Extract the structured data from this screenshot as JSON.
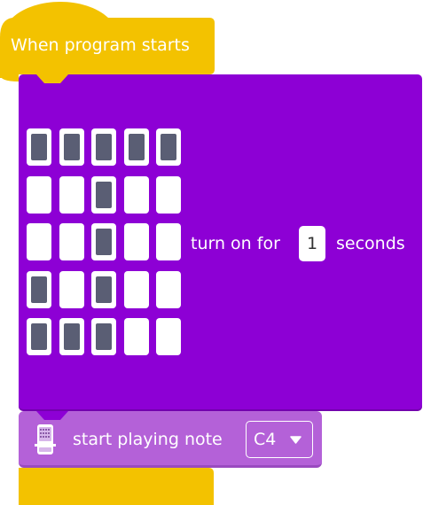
{
  "hat_block": {
    "label": "When program starts",
    "color": "#f3c200"
  },
  "led_block": {
    "color": "#8d00d5",
    "matrix": [
      [
        1,
        1,
        1,
        1,
        1
      ],
      [
        0,
        0,
        1,
        0,
        0
      ],
      [
        0,
        0,
        1,
        0,
        0
      ],
      [
        1,
        0,
        1,
        0,
        0
      ],
      [
        1,
        1,
        1,
        0,
        0
      ]
    ],
    "text_before": "turn on for",
    "seconds_value": "1",
    "text_after": "seconds"
  },
  "note_block": {
    "icon": "microbit-icon",
    "label": "start playing note",
    "note_value": "C4",
    "dropdown_icon": "chevron-down-icon",
    "color": "#b461d8"
  }
}
